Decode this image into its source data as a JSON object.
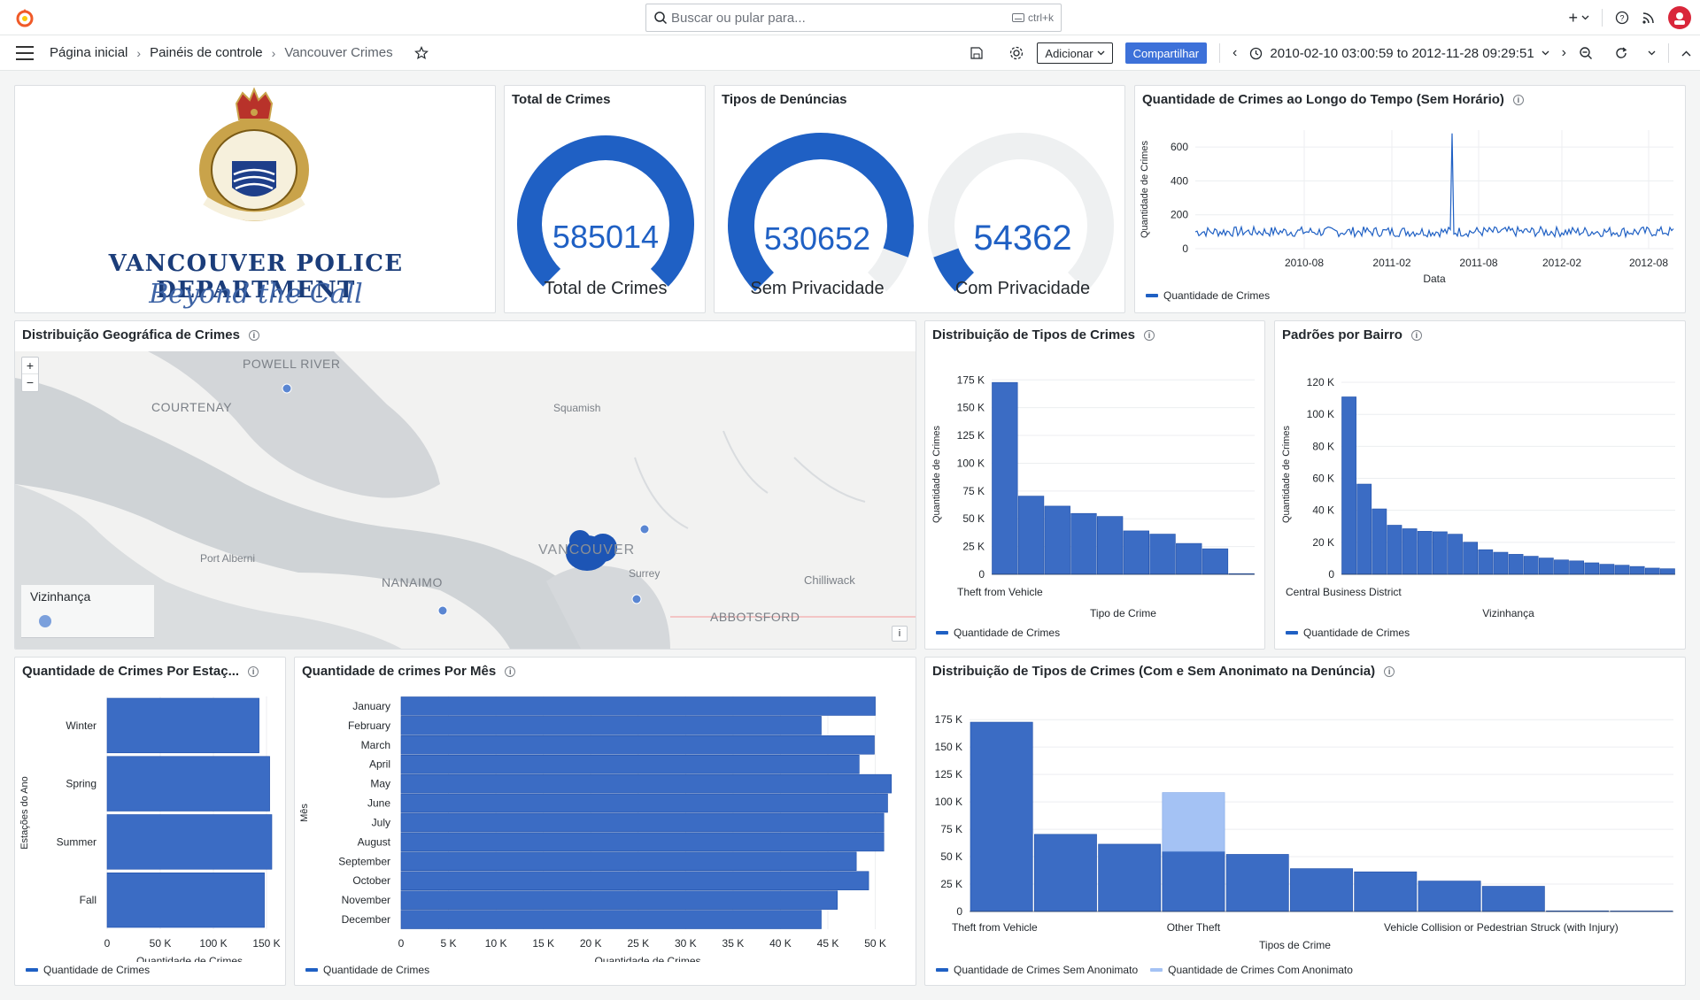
{
  "topbar": {
    "search_placeholder": "Buscar ou pular para...",
    "search_shortcut": "ctrl+k"
  },
  "nav": {
    "crumbs": [
      "Página inicial",
      "Painéis de controle",
      "Vancouver Crimes"
    ],
    "add_label": "Adicionar",
    "share_label": "Compartilhar",
    "time_range": "2010-02-10 03:00:59 to 2012-11-28 09:29:51"
  },
  "colors": {
    "accent": "#1f60c4",
    "bar": "#3b6cc4",
    "bar_light": "#a4c2f4",
    "share": "#3d71d9"
  },
  "logo_panel": {
    "title": "VANCOUVER POLICE DEPARTMENT",
    "tagline": "Beyond the Call"
  },
  "total_panel": {
    "title": "Total de Crimes",
    "value": "585014",
    "label": "Total de Crimes",
    "fraction": 1.0
  },
  "tipos_panel": {
    "title": "Tipos de Denúncias",
    "gauges": [
      {
        "value": "530652",
        "label": "Sem Privacidade",
        "fraction": 0.907
      },
      {
        "value": "54362",
        "label": "Com Privacidade",
        "fraction": 0.093
      }
    ]
  },
  "timeseries_panel": {
    "title": "Quantidade de Crimes ao Longo do Tempo (Sem Horário)",
    "legend": "Quantidade de Crimes",
    "chart_data": {
      "type": "line",
      "xlabel": "Data",
      "ylabel": "Quantidade de Crimes",
      "x_ticks": [
        "2010-08",
        "2011-02",
        "2011-08",
        "2012-02",
        "2012-08"
      ],
      "y_ticks": [
        0,
        200,
        400,
        600
      ],
      "ylim": [
        0,
        700
      ],
      "typical_value": 100,
      "spike": {
        "x": "2011-06",
        "y": 680
      }
    }
  },
  "map_panel": {
    "title": "Distribuição Geográfica de Crimes",
    "zoom_in": "+",
    "zoom_out": "−",
    "legend_title": "Vizinhança",
    "places": [
      "POWELL RIVER",
      "COURTENAY",
      "Squamish",
      "Port Alberni",
      "NANAIMO",
      "VANCOUVER",
      "Surrey",
      "Chilliwack",
      "ABBOTSFORD"
    ],
    "info_btn": "i"
  },
  "tipos_crime_panel": {
    "title": "Distribuição de Tipos de Crimes",
    "legend": "Quantidade de Crimes",
    "chart_data": {
      "type": "bar",
      "xlabel": "Tipo de Crime",
      "ylabel": "Quantidade de Crimes",
      "first_category": "Theft from Vehicle",
      "y_ticks": [
        "0",
        "25 K",
        "50 K",
        "75 K",
        "100 K",
        "125 K",
        "150 K",
        "175 K"
      ],
      "ylim": [
        0,
        180000
      ],
      "values": [
        172700,
        70400,
        61400,
        54800,
        52100,
        39100,
        36200,
        27800,
        23000,
        600
      ]
    }
  },
  "bairro_panel": {
    "title": "Padrões por Bairro",
    "legend": "Quantidade de Crimes",
    "chart_data": {
      "type": "bar",
      "xlabel": "Vizinhança",
      "ylabel": "Quantidade de Crimes",
      "first_category": "Central Business District",
      "y_ticks": [
        "0",
        "20 K",
        "40 K",
        "60 K",
        "80 K",
        "100 K",
        "120 K"
      ],
      "ylim": [
        0,
        125000
      ],
      "values": [
        110900,
        56400,
        40900,
        30700,
        28500,
        26900,
        26600,
        25100,
        20100,
        15400,
        13800,
        12500,
        11300,
        10200,
        9000,
        8400,
        7200,
        6300,
        5700,
        4900,
        3900,
        3500
      ]
    }
  },
  "estacoes_panel": {
    "title": "Quantidade de Crimes Por Estaç...",
    "legend": "Quantidade de Crimes",
    "chart_data": {
      "type": "bar",
      "orientation": "horizontal",
      "xlabel": "Quantidade de Crimes",
      "ylabel": "Estações do Ano",
      "categories": [
        "Winter",
        "Spring",
        "Summer",
        "Fall"
      ],
      "values": [
        143000,
        153000,
        155000,
        148000
      ],
      "x_ticks": [
        "0",
        "50 K",
        "100 K",
        "150 K"
      ],
      "xlim": [
        0,
        155000
      ]
    }
  },
  "mes_panel": {
    "title": "Quantidade de crimes Por Mês",
    "legend": "Quantidade de Crimes",
    "chart_data": {
      "type": "bar",
      "orientation": "horizontal",
      "xlabel": "Quantidade de Crimes",
      "ylabel": "Mês",
      "categories": [
        "January",
        "February",
        "March",
        "April",
        "May",
        "June",
        "July",
        "August",
        "September",
        "October",
        "November",
        "December"
      ],
      "values": [
        50000,
        44300,
        49900,
        48300,
        51700,
        51300,
        50900,
        50900,
        48000,
        49300,
        46000,
        44300
      ],
      "x_ticks": [
        "0",
        "5 K",
        "10 K",
        "15 K",
        "20 K",
        "25 K",
        "30 K",
        "35 K",
        "40 K",
        "45 K",
        "50 K"
      ],
      "xlim": [
        0,
        52000
      ]
    }
  },
  "anon_panel": {
    "title": "Distribuição de Tipos de Crimes (Com e Sem Anonimato na Denúncia)",
    "chart_data": {
      "type": "bar",
      "xlabel": "Tipos de Crime",
      "x_tick_labels": [
        "Theft from Vehicle",
        "Other Theft",
        "Vehicle Collision or Pedestrian Struck (with Injury)"
      ],
      "y_ticks": [
        "0",
        "25 K",
        "50 K",
        "75 K",
        "100 K",
        "125 K",
        "150 K",
        "175 K"
      ],
      "ylim": [
        0,
        180000
      ],
      "series": [
        {
          "name": "Quantidade de Crimes Sem Anonimato",
          "values": [
            172700,
            70400,
            61400,
            54800,
            52100,
            39100,
            36200,
            27800,
            23000,
            600,
            500
          ]
        },
        {
          "name": "Quantidade de Crimes Com Anonimato",
          "values": [
            0,
            0,
            0,
            108500,
            0,
            0,
            0,
            0,
            0,
            0,
            0
          ]
        }
      ]
    }
  }
}
